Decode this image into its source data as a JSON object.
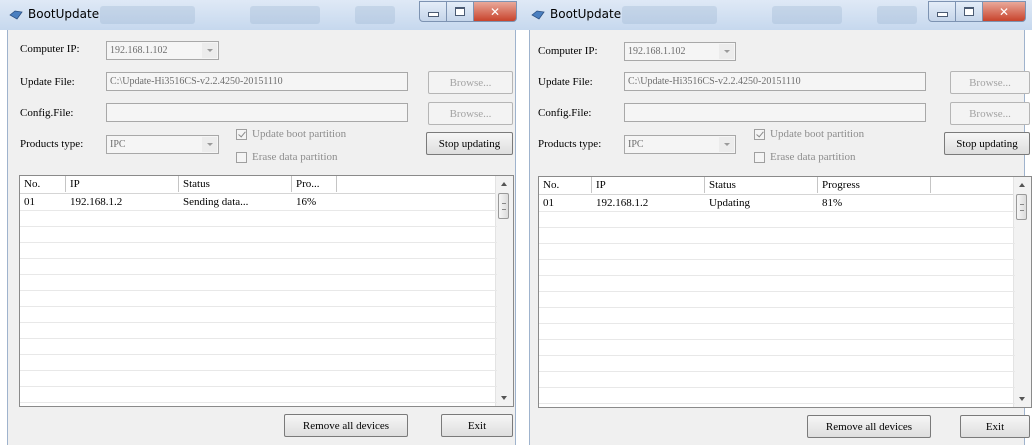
{
  "windows": [
    {
      "title": "BootUpdate",
      "computer_ip_label": "Computer IP:",
      "computer_ip_value": "192.168.1.102",
      "update_file_label": "Update File:",
      "update_file_value": "C:\\Update-Hi3516CS-v2.2.4250-20151110",
      "config_file_label": "Config.File:",
      "config_file_value": "",
      "browse_label": "Browse...",
      "products_type_label": "Products type:",
      "products_type_value": "IPC",
      "update_boot_label": "Update boot partition",
      "update_boot_checked": true,
      "erase_data_label": "Erase data partition",
      "erase_data_checked": false,
      "stop_updating_label": "Stop updating",
      "list_columns": [
        "No.",
        "IP",
        "Status",
        "Pro..."
      ],
      "rows": [
        {
          "no": "01",
          "ip": "192.168.1.2",
          "status": "Sending data...",
          "progress": "16%"
        }
      ],
      "remove_all_label": "Remove all devices",
      "exit_label": "Exit"
    },
    {
      "title": "BootUpdate",
      "computer_ip_label": "Computer IP:",
      "computer_ip_value": "192.168.1.102",
      "update_file_label": "Update File:",
      "update_file_value": "C:\\Update-Hi3516CS-v2.2.4250-20151110",
      "config_file_label": "Config.File:",
      "config_file_value": "",
      "browse_label": "Browse...",
      "products_type_label": "Products type:",
      "products_type_value": "IPC",
      "update_boot_label": "Update boot partition",
      "update_boot_checked": true,
      "erase_data_label": "Erase data partition",
      "erase_data_checked": false,
      "stop_updating_label": "Stop updating",
      "list_columns": [
        "No.",
        "IP",
        "Status",
        "Progress"
      ],
      "rows": [
        {
          "no": "01",
          "ip": "192.168.1.2",
          "status": "Updating",
          "progress": "81%"
        }
      ],
      "remove_all_label": "Remove all devices",
      "exit_label": "Exit"
    }
  ],
  "colors": {
    "titlebar": "#c6d8ee",
    "close_button": "#c8432c",
    "client_bg": "#f0f0f0"
  },
  "icons": [
    "bootupdate-app-icon",
    "minimize-icon",
    "maximize-icon",
    "close-icon",
    "dropdown-arrow-icon",
    "scroll-up-icon",
    "scroll-down-icon"
  ]
}
